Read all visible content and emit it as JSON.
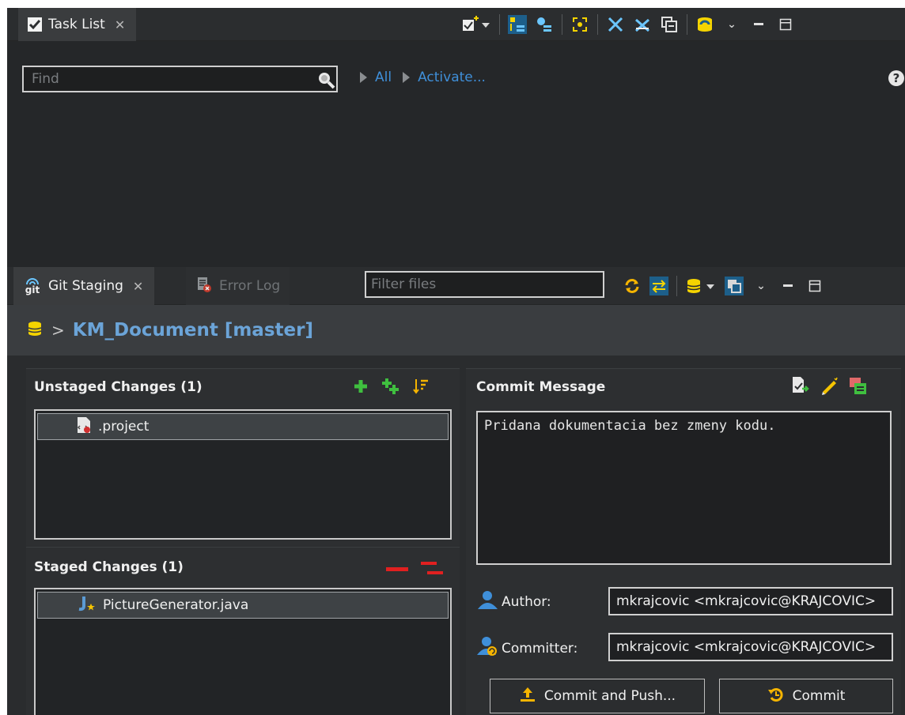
{
  "task_list": {
    "tab_label": "Task List",
    "find_placeholder": "Find",
    "link_all": "All",
    "link_activate": "Activate...",
    "help_glyph": "?"
  },
  "git_staging": {
    "tab_label": "Git Staging",
    "git_icon_text": "git",
    "error_log_tab": "Error Log",
    "filter_placeholder": "Filter files",
    "repo_separator": ">",
    "repo_title": "KM_Document [master]",
    "unstaged": {
      "title": "Unstaged Changes (1)",
      "items": [
        ".project"
      ]
    },
    "staged": {
      "title": "Staged Changes (1)",
      "items": [
        "PictureGenerator.java"
      ]
    },
    "commit": {
      "title": "Commit Message",
      "message": "Pridana dokumentacia bez zmeny kodu.",
      "author_label": "Author:",
      "author_value": "mkrajcovic <mkrajcovic@KRAJCOVIC>",
      "committer_label": "Committer:",
      "committer_value": "mkrajcovic <mkrajcovic@KRAJCOVIC>",
      "commit_and_push_label": "Commit and Push...",
      "commit_label": "Commit"
    }
  },
  "colors": {
    "accent_blue": "#3f8fd9",
    "repo_title": "#6ba4d8",
    "add_green": "#3fbf3f",
    "remove_red": "#e02020",
    "db_yellow": "#f5d400"
  },
  "icons": [
    "task-list-icon",
    "close-icon",
    "new-task-icon",
    "search-icon",
    "help-icon",
    "git-icon",
    "error-log-icon",
    "refresh-icon",
    "compare-icon",
    "repository-icon",
    "presentation-icon",
    "view-menu-icon",
    "minimize-icon",
    "maximize-icon",
    "add-icon",
    "add-all-icon",
    "sort-icon",
    "remove-icon",
    "remove-all-icon",
    "xml-file-icon",
    "java-file-icon",
    "sign-off-icon",
    "edit-icon",
    "change-id-icon",
    "author-icon",
    "committer-icon",
    "push-icon",
    "commit-icon"
  ]
}
